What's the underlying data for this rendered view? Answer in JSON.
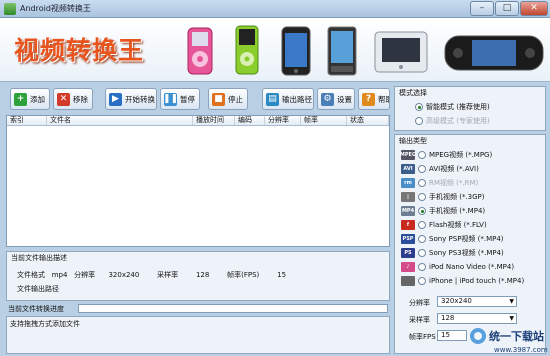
{
  "window": {
    "title": "Android视频转换王",
    "btn_min": "–",
    "btn_max": "□",
    "btn_close": "✕"
  },
  "banner": {
    "logo_text": "视频转换王",
    "devices": [
      "ipod-nano-pink",
      "ipod-green",
      "iphone",
      "android-phone",
      "dvd-player",
      "psp"
    ]
  },
  "toolbar": {
    "add": "添加",
    "remove": "移除",
    "start": "开始转换",
    "pause": "暂停",
    "stop": "停止",
    "output_path": "输出路径",
    "settings": "设置",
    "help": "帮助"
  },
  "table": {
    "columns": [
      "索引",
      "文件名",
      "播放时间",
      "编码",
      "分辨率",
      "帧率",
      "状态"
    ],
    "rows": []
  },
  "desc": {
    "title": "当前文件输出描述",
    "format_label": "文件格式",
    "format_value": "mp4",
    "res_label": "分辨率",
    "res_value": "320x240",
    "bitrate_label": "采样率",
    "bitrate_value": "128",
    "fps_label": "帧率(FPS)",
    "fps_value": "15",
    "output_label": "文件输出路径"
  },
  "progress": {
    "label": "当前文件转换进度",
    "value": 0
  },
  "status": {
    "text": "支持拖拽方式添加文件"
  },
  "mode": {
    "title": "模式选择",
    "options": [
      {
        "label": "智能模式 (推荐使用)",
        "checked": true,
        "disabled": false
      },
      {
        "label": "高级模式 (专家使用)",
        "checked": false,
        "disabled": true
      }
    ]
  },
  "output_type": {
    "title": "输出类型",
    "options": [
      {
        "label": "MPEG视频 (*.MPG)",
        "icon": "mpeg-icon",
        "checked": false,
        "disabled": false
      },
      {
        "label": "AVI视频 (*.AVI)",
        "icon": "avi-icon",
        "checked": false,
        "disabled": false
      },
      {
        "label": "RM视频 (*.RM)",
        "icon": "rm-icon",
        "checked": false,
        "disabled": true
      },
      {
        "label": "手机视频 (*.3GP)",
        "icon": "mobile-3gp-icon",
        "checked": false,
        "disabled": false
      },
      {
        "label": "手机视频 (*.MP4)",
        "icon": "mp4-icon",
        "checked": true,
        "disabled": false
      },
      {
        "label": "Flash视频 (*.FLV)",
        "icon": "flash-icon",
        "checked": false,
        "disabled": false
      },
      {
        "label": "Sony PSP视频 (*.MP4)",
        "icon": "psp-icon",
        "checked": false,
        "disabled": false
      },
      {
        "label": "Sony PS3视频 (*.MP4)",
        "icon": "ps3-icon",
        "checked": false,
        "disabled": false
      },
      {
        "label": "iPod Nano Video (*.MP4)",
        "icon": "ipod-nano-icon",
        "checked": false,
        "disabled": false
      },
      {
        "label": "iPhone | iPod touch (*.MP4)",
        "icon": "apple-icon",
        "checked": false,
        "disabled": false
      }
    ]
  },
  "settings": {
    "res_label": "分辨率",
    "res_value": "320x240",
    "bitrate_label": "采样率",
    "bitrate_value": "128",
    "fps_label": "帧率FPS",
    "fps_value": "15"
  },
  "watermark": {
    "text": "统一下载站",
    "url": "www.3987.com"
  }
}
